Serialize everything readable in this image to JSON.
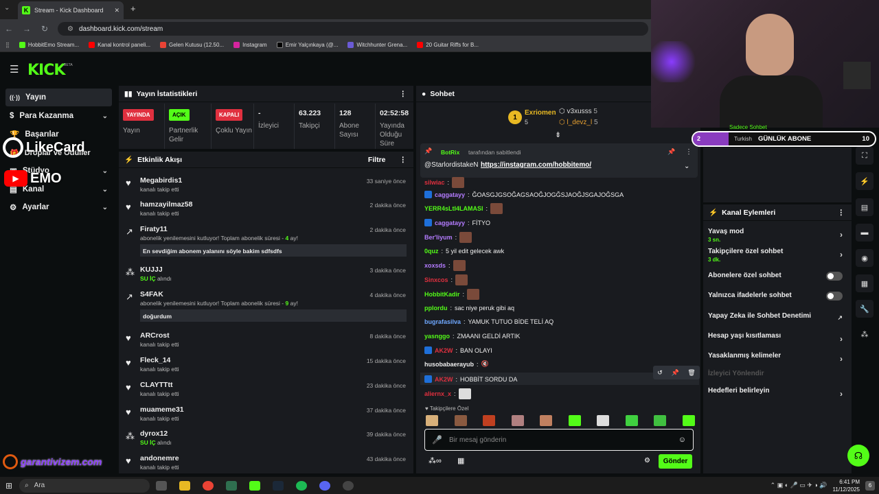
{
  "browser": {
    "tab_title": "Stream - Kick Dashboard",
    "url": "dashboard.kick.com/stream",
    "bookmarks": [
      "HobbitEmo Stream...",
      "Kanal kontrol paneli...",
      "Gelen Kutusu (12.50...",
      "Instagram",
      "Emir Yalçınkaya (@...",
      "Witchhunter Grena...",
      "20 Guitar Riffs for B..."
    ]
  },
  "app": {
    "logo": "KICK",
    "beta": "BETA"
  },
  "sidebar": {
    "items": [
      {
        "label": "Yayın"
      },
      {
        "label": "Para Kazanma"
      },
      {
        "label": "Başarılar"
      },
      {
        "label": "Droplar ve Ödüller"
      },
      {
        "label": "Stüdyo"
      },
      {
        "label": "Kanal"
      },
      {
        "label": "Ayarlar"
      }
    ]
  },
  "overlays": {
    "likecard": "LikeCard",
    "emo": "EMO",
    "garanti": "garantivizem.com"
  },
  "stats": {
    "title": "Yayın İstatistikleri",
    "cells": [
      {
        "badge": "YAYINDA",
        "label": "Yayın"
      },
      {
        "badge": "AÇIK",
        "label": "Partnerlik Gelir"
      },
      {
        "badge": "KAPALI",
        "label": "Çoklu Yayın"
      },
      {
        "value": "-",
        "label": "İzleyici"
      },
      {
        "value": "63.223",
        "label": "Takipçi"
      },
      {
        "value": "128",
        "label": "Abone Sayısı"
      },
      {
        "value": "02:52:58",
        "label": "Yayında Olduğu Süre"
      }
    ]
  },
  "activity": {
    "title": "Etkinlik Akışı",
    "filter": "Filtre",
    "items": [
      {
        "name": "Megabirdis1",
        "sub": "kanalı takip etti",
        "time": "33 saniye önce"
      },
      {
        "name": "hamzayilmaz58",
        "sub": "kanalı takip etti",
        "time": "2 dakika önce"
      },
      {
        "name": "Firaty11",
        "sub": "abonelik yenilemesini kutluyor! Toplam abonelik süresi -",
        "months": "4",
        "suffix": "ay!",
        "time": "2 dakika önce",
        "msg": "En sevdiğim abonem yalanını söyle bakim sdfsdfs"
      },
      {
        "name": "KUJJJ",
        "gift": "SU İÇ",
        "sub": "alındı",
        "time": "3 dakika önce"
      },
      {
        "name": "S4FAK",
        "sub": "abonelik yenilemesini kutluyor! Toplam abonelik süresi -",
        "months": "9",
        "suffix": "ay!",
        "time": "4 dakika önce",
        "msg": "doğurdum"
      },
      {
        "name": "ARCrost",
        "sub": "kanalı takip etti",
        "time": "8 dakika önce"
      },
      {
        "name": "Fleck_14",
        "sub": "kanalı takip etti",
        "time": "15 dakika önce"
      },
      {
        "name": "CLAYTTtt",
        "sub": "kanalı takip etti",
        "time": "23 dakika önce"
      },
      {
        "name": "muameme31",
        "sub": "kanalı takip etti",
        "time": "37 dakika önce"
      },
      {
        "name": "dyrox12",
        "gift": "SU İÇ",
        "sub": "alındı",
        "time": "39 dakika önce"
      },
      {
        "name": "andonemre",
        "sub": "kanalı takip etti",
        "time": "43 dakika önce"
      }
    ]
  },
  "chat": {
    "title": "Sohbet",
    "leaderboard": [
      {
        "rank": "1",
        "name": "Exriomen",
        "count": "5"
      },
      {
        "name": "v3xusss",
        "count": "5"
      },
      {
        "name": "l_devz_l",
        "count": "5"
      }
    ],
    "pinned": {
      "by": "BotRix",
      "suffix": "tarafından sabitlendi",
      "text": "@StarlordistakeN",
      "link": "https://instagram.com/hobbitemo/"
    },
    "messages": [
      {
        "u": "silwiac",
        "c": "#e0303f",
        "t": ""
      },
      {
        "u": "caggatayy",
        "c": "#b47cff",
        "t": "ĞOASGJGSOĞAGSAOĞJOGĞSJAOĞJSGAJOĞSGA"
      },
      {
        "u": "YERR4sLtI4LAMASI",
        "c": "#53fc18",
        "t": ""
      },
      {
        "u": "caggatayy",
        "c": "#b47cff",
        "t": "FİTYO"
      },
      {
        "u": "Ber'liyum",
        "c": "#b47cff",
        "t": ""
      },
      {
        "u": "0quz",
        "c": "#53fc18",
        "t": "5 yil edit gelecek awk"
      },
      {
        "u": "xoxsds",
        "c": "#b47cff",
        "t": ""
      },
      {
        "u": "Sinxcos",
        "c": "#e0303f",
        "t": ""
      },
      {
        "u": "HobbitKadir",
        "c": "#53fc18",
        "t": ""
      },
      {
        "u": "pplordu",
        "c": "#53fc18",
        "t": "sac niye peruk gibi aq"
      },
      {
        "u": "bugrafasilva",
        "c": "#6fa8ff",
        "t": "YAMUK TUTUO BİDE TELİ AQ"
      },
      {
        "u": "yasnggo",
        "c": "#53fc18",
        "t": "ZMAANI GELDİ ARTIK"
      },
      {
        "u": "AK2W",
        "c": "#e0303f",
        "t": "BAN OLAYI"
      },
      {
        "u": "husobabaerayub",
        "c": "#eeeeee",
        "t": ""
      },
      {
        "u": "AK2W",
        "c": "#e0303f",
        "t": "HOBBİT SORDU DA"
      },
      {
        "u": "aliernx_x",
        "c": "#e0303f",
        "t": ""
      }
    ],
    "emote_section": "Takipçilere Özel",
    "input_placeholder": "Bir mesaj gönderin",
    "send": "Gönder"
  },
  "stream_overlay": {
    "rank": "2",
    "lang": "Turkish",
    "goal": "GÜNLÜK ABONE",
    "count": "10",
    "ticker": "Sadece Sohbet"
  },
  "channel_actions": {
    "title": "Kanal Eylemleri",
    "rows": [
      {
        "label": "Yavaş mod",
        "sub": "3 sn."
      },
      {
        "label": "Takipçilere özel sohbet",
        "sub": "3 dk."
      },
      {
        "label": "Abonelere özel sohbet"
      },
      {
        "label": "Yalnızca ifadelerle sohbet"
      },
      {
        "label": "Yapay Zeka ile Sohbet Denetimi"
      },
      {
        "label": "Hesap yaşı kısıtlaması"
      },
      {
        "label": "Yasaklanmış kelimeler"
      },
      {
        "label": "İzleyici Yönlendir"
      },
      {
        "label": "Hedefleri belirleyin"
      }
    ]
  },
  "taskbar": {
    "search": "Ara",
    "time": "6:41 PM",
    "date": "11/12/2025",
    "notif": "6"
  },
  "colors": {
    "accent": "#53fc18",
    "live": "#e0303f",
    "bg": "#0b0e0f",
    "panel": "#191b1f"
  }
}
